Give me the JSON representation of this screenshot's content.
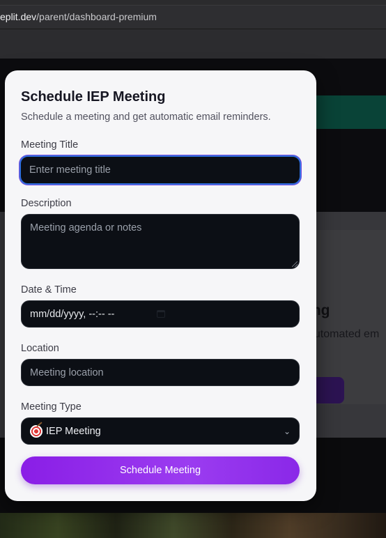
{
  "browser": {
    "url_host": "eplit.dev",
    "url_path": "/parent/dashboard-premium"
  },
  "background": {
    "heading_fragment": "ing",
    "subtext_fragment": "automated em",
    "button_fragment": "g"
  },
  "modal": {
    "title": "Schedule IEP Meeting",
    "description": "Schedule a meeting and get automatic email reminders.",
    "fields": {
      "title": {
        "label": "Meeting Title",
        "placeholder": "Enter meeting title"
      },
      "description": {
        "label": "Description",
        "placeholder": "Meeting agenda or notes"
      },
      "datetime": {
        "label": "Date & Time",
        "value": "mm/dd/yyyy, --:-- --",
        "icon": "calendar-icon"
      },
      "location": {
        "label": "Location",
        "placeholder": "Meeting location"
      },
      "type": {
        "label": "Meeting Type",
        "value": "IEP Meeting",
        "icon": "target-emoji-icon"
      }
    },
    "submit_label": "Schedule Meeting"
  },
  "colors": {
    "accent": "#8a1ee6",
    "focus_ring": "#2f6fe0",
    "input_bg": "#0c0f15"
  }
}
